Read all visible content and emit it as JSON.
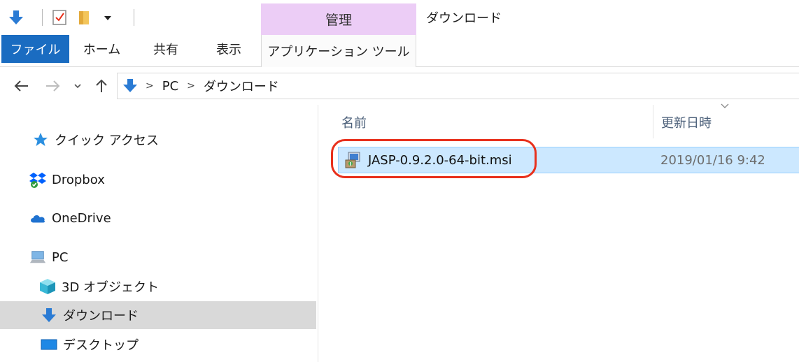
{
  "quick_access_toolbar": {
    "icons": [
      "download-arrow-icon",
      "properties-checklist-icon",
      "new-folder-icon",
      "customize-dropdown-icon"
    ]
  },
  "contextual_tab_group": "管理",
  "window_title": "ダウンロード",
  "ribbon_tabs": {
    "file": "ファイル",
    "home": "ホーム",
    "share": "共有",
    "view": "表示",
    "app_tools": "アプリケーション ツール"
  },
  "address_bar": {
    "crumbs": [
      "PC",
      "ダウンロード"
    ]
  },
  "nav_pane": {
    "items": [
      {
        "label": "クイック アクセス",
        "icon": "star-icon"
      },
      {
        "label": "Dropbox",
        "icon": "dropbox-icon"
      },
      {
        "label": "OneDrive",
        "icon": "cloud-icon"
      },
      {
        "label": "PC",
        "icon": "computer-icon"
      },
      {
        "label": "3D オブジェクト",
        "icon": "cube-icon"
      },
      {
        "label": "ダウンロード",
        "icon": "download-arrow-icon",
        "selected": true
      },
      {
        "label": "デスクトップ",
        "icon": "desktop-icon"
      }
    ]
  },
  "file_list": {
    "columns": {
      "name": "名前",
      "date_modified": "更新日時"
    },
    "rows": [
      {
        "name": "JASP-0.9.2.0-64-bit.msi",
        "date": "2019/01/16 9:42",
        "selected": true
      }
    ]
  },
  "colors": {
    "file_tab": "#1a6cc1",
    "contextual_tab": "#eccdf6",
    "selection": "#cce8ff",
    "highlight_ring": "#e8301c",
    "download_blue": "#2a7bd4"
  }
}
